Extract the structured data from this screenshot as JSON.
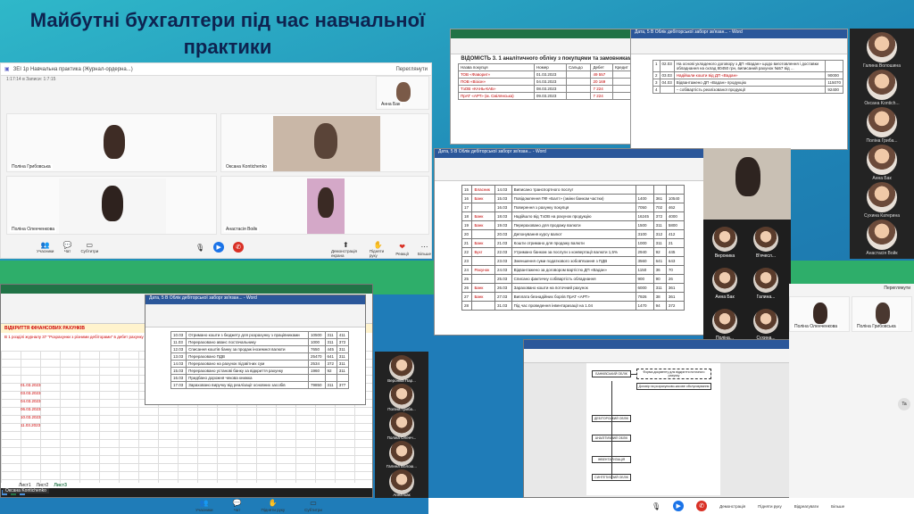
{
  "title": "Майбутні бухгалтери під час навчальної практики",
  "teams_top": {
    "meeting_title": "ЗЕІ 1р Навчальна практика (Журнал-ордерна...)",
    "subtitle": "1:17:14 в Записи: 1:7:15",
    "participants_btn": "Переглянути",
    "tiles": [
      {
        "name": "Поліна Грибовська"
      },
      {
        "name": "Оксана Kontichenko"
      },
      {
        "name": "Поліна Оленченкова"
      },
      {
        "name": "Анастасія Войк"
      },
      {
        "name": "Анна Бак"
      }
    ],
    "controls": [
      "Учасники",
      "Чат",
      "Субтитри",
      "Демонстрація екрана",
      "Підняти руку",
      "Реакції",
      "Більше"
    ]
  },
  "excel_top": {
    "title": "ВІДОМІСТЬ 3. 1 аналітичного обліку з покупцями та замовниками",
    "cols": [
      "Назва покупця",
      "Номер",
      "Сальдо",
      "Дебет",
      "Кредит"
    ],
    "rows": [
      {
        "name": "ТОВ «Фаворит»",
        "date": "01.03.2023",
        "sum": "49 557"
      },
      {
        "name": "ПОВ «Візіон»",
        "date": "04.03.2023",
        "sum": "20 169"
      },
      {
        "name": "ТзОВ «КАНЬ-КАБ»",
        "date": "08.03.2023",
        "sum": "7 224"
      },
      {
        "name": "ПрАТ «АРТ» (м. Смілянська)",
        "date": "09.03.2023",
        "sum": "7 224"
      }
    ]
  },
  "word_top": {
    "title": "Дата, 5 В Облік дебіторської заборг зв'язан... - Word",
    "rows": [
      {
        "n": "1",
        "date": "02.03",
        "text": "На основі укладеного договору з ДП «Вадан» щодо виготовлення і доставки обладнання на склад 80450 грн, виписаний рахунок №57 від ..."
      },
      {
        "n": "2",
        "date": "03.03",
        "text": "Надійшли кошти від ДП «Вадан»",
        "val": "90000"
      },
      {
        "n": "3",
        "date": "04.03",
        "text": "Відвантажено ДП «Вадан» продукцію",
        "val": "115070"
      },
      {
        "n": "4",
        "date": "",
        "text": "– собівартість реалізованої продукції",
        "val": "92400"
      }
    ]
  },
  "word_mid": {
    "title": "Дата, 5 В Облік дебіторської заборг зв'язан... - Word",
    "rows": [
      {
        "n": "15",
        "who": "Власник",
        "d": "14.03",
        "text": "Виписано транспортного послуг",
        "a": "",
        "b": "",
        "c": ""
      },
      {
        "n": "16",
        "who": "Банк",
        "d": "15.03",
        "text": "Повідомлення ПФ «Балт» (зміни банком частки)",
        "a": "1400",
        "b": "361",
        "c": "10540"
      },
      {
        "n": "17",
        "who": "",
        "d": "16.03",
        "text": "Поверення з рахунку покупця",
        "a": "7050",
        "b": "702",
        "c": "462"
      },
      {
        "n": "18",
        "who": "Банк",
        "d": "18.03",
        "text": "Надійшло від ТзОВ на рахунок продукцію",
        "a": "16245",
        "b": "372",
        "c": "4000"
      },
      {
        "n": "19",
        "who": "Банк",
        "d": "19.03",
        "text": "Перераховано для продажу валюти",
        "a": "1500",
        "b": "311",
        "c": "5800"
      },
      {
        "n": "20",
        "who": "",
        "d": "20.03",
        "text": "Депонування курсу валют",
        "a": "3100",
        "b": "312",
        "c": "412"
      },
      {
        "n": "21",
        "who": "Банк",
        "d": "21.03",
        "text": "Кошти отримано для продажу валюти",
        "a": "1000",
        "b": "311",
        "c": "21"
      },
      {
        "n": "22",
        "who": "Бухг",
        "d": "22.03",
        "text": "Утримано банком за послуги з конвертації валюти 1,5%",
        "a": "2940",
        "b": "92",
        "c": "445"
      },
      {
        "n": "23",
        "who": "",
        "d": "23.03",
        "text": "Зменшення суми податкового зобов'язання з ПДВ",
        "a": "3560",
        "b": "641",
        "c": "643"
      },
      {
        "n": "24",
        "who": "Рахунок",
        "d": "24.03",
        "text": "Відвантажено за договором вартістю ДП «Вадан»",
        "a": "1150",
        "b": "36",
        "c": "70"
      },
      {
        "n": "25",
        "who": "",
        "d": "25.03",
        "text": "Списано фактичну собівартість обладнання",
        "a": "900",
        "b": "90",
        "c": "26"
      },
      {
        "n": "26",
        "who": "Банк",
        "d": "26.03",
        "text": "Зараховано кошти на поточний рахунок",
        "a": "6000",
        "b": "311",
        "c": "361"
      },
      {
        "n": "27",
        "who": "Банк",
        "d": "27.03",
        "text": "Виплата безнадійних боргів ПрАТ «АРТ»",
        "a": "7926",
        "b": "38",
        "c": "361"
      },
      {
        "n": "28",
        "who": "",
        "d": "31.03",
        "text": "Під час проведення інвентаризації на 1.04",
        "a": "1470",
        "b": "94",
        "c": "372"
      }
    ]
  },
  "gallery": [
    {
      "name": "Вероника"
    },
    {
      "name": "В'ячесл..."
    },
    {
      "name": "Анна Бак"
    },
    {
      "name": "Галина..."
    },
    {
      "name": "Поліна..."
    },
    {
      "name": "Сухина..."
    }
  ],
  "side_top": [
    {
      "name": "Галина Волошина"
    },
    {
      "name": "Оксана Kontich..."
    },
    {
      "name": "Поліна Гриба..."
    },
    {
      "name": "Анна Бак"
    },
    {
      "name": "Сухина Катерина"
    },
    {
      "name": "Анастасія Войк"
    }
  ],
  "excel_bot": {
    "sheet_title": "ВІДКРИТТЯ ФІНАНСОВИХ РАХУНКІВ",
    "header": "В 1 розділі журналу 37 \"Розрахунки з різними дебіторами\" в дебет рахунку",
    "sheets": [
      "Лист1",
      "Лист2",
      "Лист3"
    ],
    "dates": [
      "01.03.2023",
      "03.03.2023",
      "04.03.2023",
      "06.03.2023",
      "10.03.2023",
      "11.03.2023"
    ],
    "user": "Оксана Kontichenko"
  },
  "word_small": {
    "title": "Дата, 5 В Облік дебіторської заборг зв'язан... - Word",
    "rows": [
      {
        "n": "10.03",
        "text": "Отримано кошти з бюджету для розрахунку з працівниками",
        "a": "10500",
        "b": "311",
        "c": "411"
      },
      {
        "n": "11.03",
        "text": "Перераховано аванс постачальнику",
        "a": "1000",
        "b": "311",
        "c": "372"
      },
      {
        "n": "12.03",
        "text": "Списання коштів банку за продаж іноземної валюти",
        "a": "7650",
        "b": "445",
        "c": "311"
      },
      {
        "n": "13.03",
        "text": "Перераховано ПДВ",
        "a": "25470",
        "b": "641",
        "c": "311"
      },
      {
        "n": "14.03",
        "text": "Перераховано на рахунок підзвітних сум",
        "a": "2534",
        "b": "372",
        "c": "311"
      },
      {
        "n": "15.03",
        "text": "Перераховано установі банку за відкриття рахунку",
        "a": "1960",
        "b": "92",
        "c": "311"
      },
      {
        "n": "16.03",
        "text": "Придбано дорожня чекова книжка",
        "a": "",
        "b": "",
        "c": ""
      },
      {
        "n": "17.03",
        "text": "Зараховано виручку від реалізації основних засобів",
        "a": "79850",
        "b": "311",
        "c": "377"
      }
    ]
  },
  "strip": [
    {
      "name": "Вероніка Пар..."
    },
    {
      "name": "Поліна Гриба..."
    },
    {
      "name": "Поліна Оленч..."
    },
    {
      "name": "Галина Волош..."
    },
    {
      "name": "Анна Бак"
    }
  ],
  "teams_bot": {
    "participants_btn": "Переглянути",
    "tiles": [
      {
        "name": "Поліна Оленченкова"
      },
      {
        "name": "Поліна Грибовська"
      }
    ]
  },
  "diagram": {
    "boxes": [
      "БАНКІВСЬКИЙ ОБЛІК",
      "Форма документу для відкриття поточного рахунку",
      "Договір на розрахунково-касове обслуговування",
      "ДЕБІТОРСЬКИЙ ОБЛІК",
      "АНАЛІТИЧНИЙ ОБЛІК",
      "ІНВЕНТАРИЗАЦІЯ",
      "СИНТЕТИЧНИЙ ОБЛІК"
    ]
  },
  "bottom_controls": [
    "Учасники",
    "Чат",
    "Підняти руку",
    "Субтитри"
  ],
  "right_controls": [
    "Демонстрація",
    "Підняти руку",
    "Відреагувати",
    "Більше"
  ],
  "colors": {
    "word_blue": "#2b579a",
    "excel_green": "#217346",
    "teams_red": "#d93025"
  }
}
